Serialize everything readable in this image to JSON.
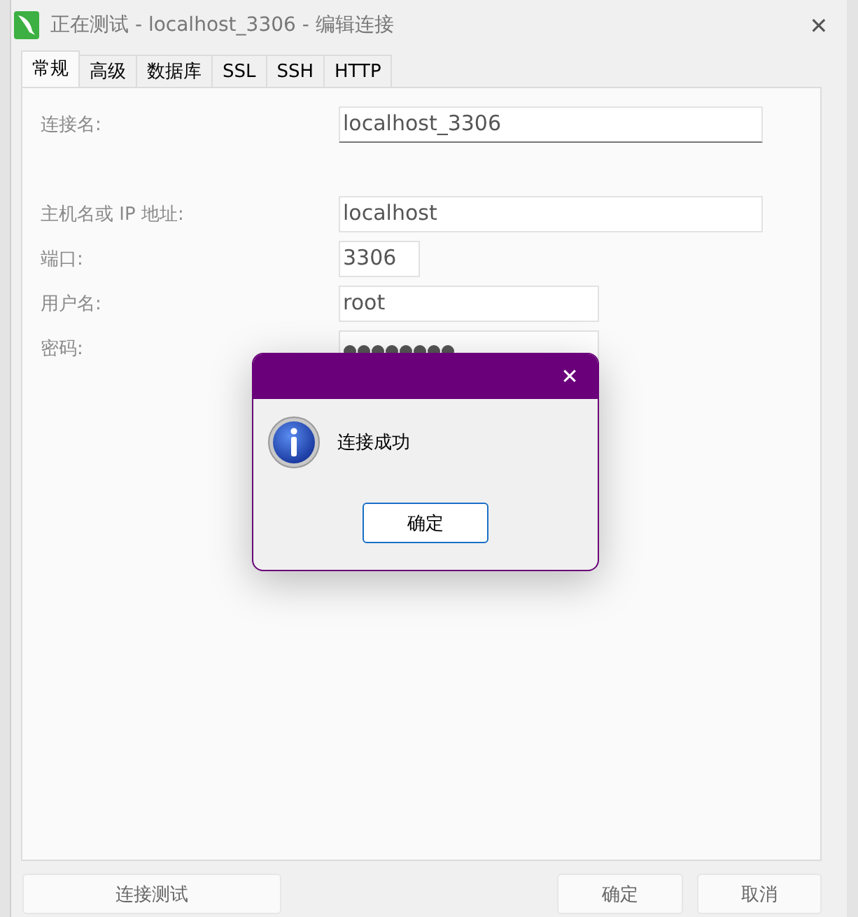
{
  "window": {
    "title": "正在测试 - localhost_3306 - 编辑连接",
    "close": "✕"
  },
  "tabs": [
    {
      "label": "常规",
      "selected": true
    },
    {
      "label": "高级",
      "selected": false
    },
    {
      "label": "数据库",
      "selected": false
    },
    {
      "label": "SSL",
      "selected": false
    },
    {
      "label": "SSH",
      "selected": false
    },
    {
      "label": "HTTP",
      "selected": false
    }
  ],
  "fields": [
    {
      "kind": "name",
      "label": "连接名:",
      "value": "localhost_3306",
      "focused": true
    },
    {
      "kind": "host",
      "label": "主机名或 IP 地址:",
      "value": "localhost",
      "focused": false
    },
    {
      "kind": "port",
      "label": "端口:",
      "value": "3306",
      "focused": false
    },
    {
      "kind": "user",
      "label": "用户名:",
      "value": "root",
      "focused": false
    },
    {
      "kind": "password",
      "label": "密码:"
    }
  ],
  "dialog": {
    "close": "✕",
    "message": "连接成功",
    "button": "确定"
  },
  "buttons": [
    {
      "label": "连接测试",
      "kind": "left"
    },
    {
      "label": "确定",
      "kind": "right"
    },
    {
      "label": "取消",
      "kind": "right"
    }
  ]
}
